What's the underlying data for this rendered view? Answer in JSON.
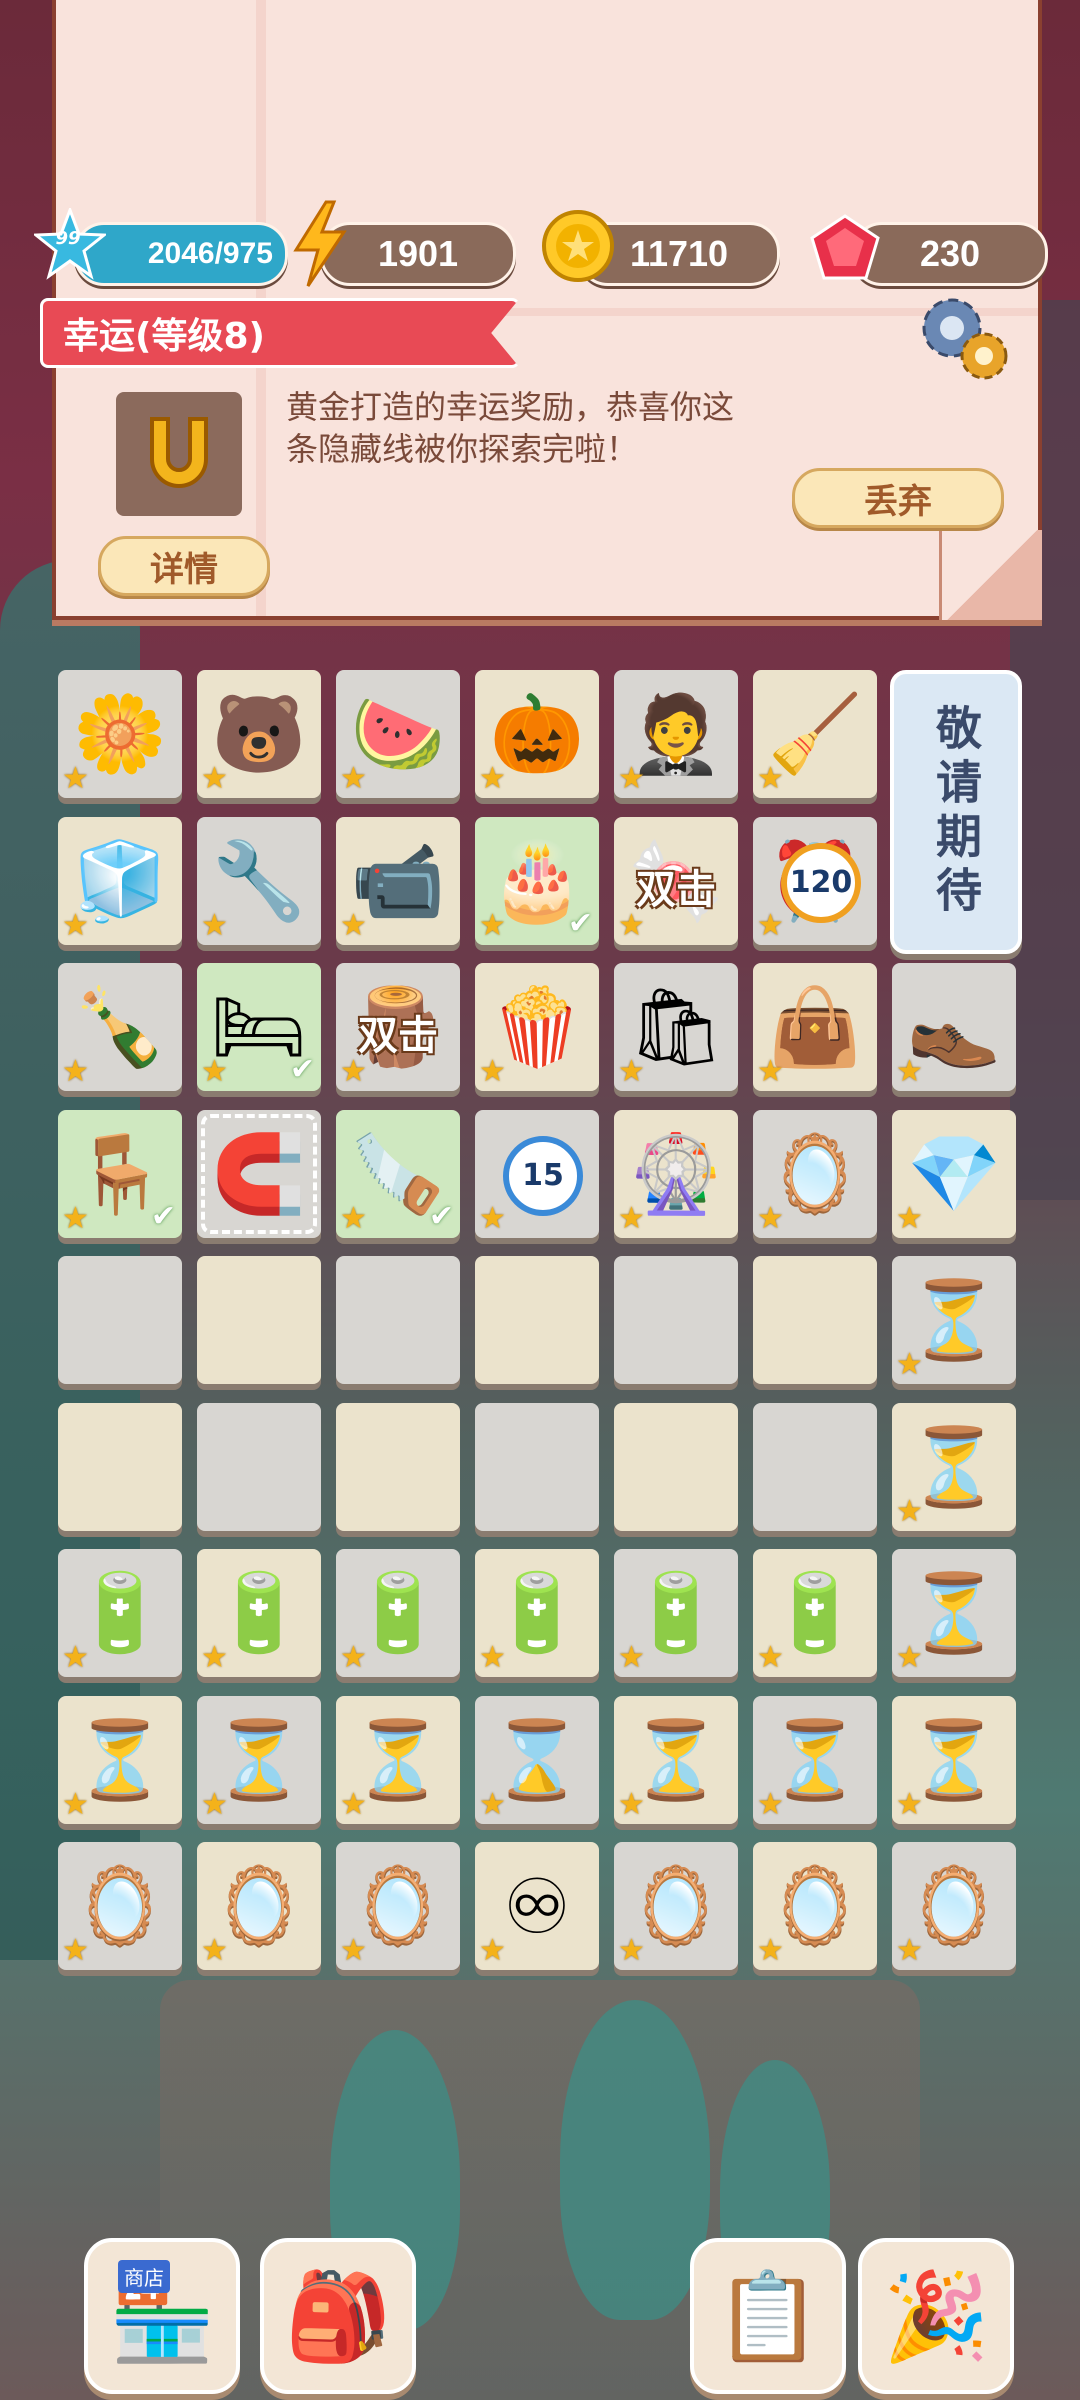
{
  "resources": {
    "exp_level": "99",
    "exp": "2046/975",
    "energy": "1901",
    "coins": "11710",
    "gems": "230"
  },
  "detail": {
    "title": "幸运(等级8)",
    "description": "黄金打造的幸运奖励，恭喜你这条隐藏线被你探索完啦！",
    "details_button": "详情",
    "discard_button": "丢弃"
  },
  "grid": {
    "coming_soon": "敬请期待",
    "combo_label": "双击",
    "timer_value": "120",
    "ball_number": "15",
    "rows": [
      [
        "daisy-flower",
        "bear",
        "watermelon",
        "pumpkin",
        "tuxedo",
        "vacuum"
      ],
      [
        "air-conditioner",
        "power-drill",
        "camcorder",
        "birthday-cake",
        "candy-jar-combo",
        "alarm-clock-120"
      ],
      [
        "wine-bottles",
        "bed",
        "firewood-combo",
        "popcorn",
        "shopping-bags",
        "pink-shopping-bag",
        "leather-shoes"
      ],
      [
        "wooden-stool",
        "horseshoe",
        "saw",
        "billiard-ball-15",
        "roulette",
        "rainbow-hand-mirror",
        "rainbow-perfume"
      ],
      [
        "empty",
        "empty",
        "empty",
        "empty",
        "empty",
        "empty",
        "hourglass"
      ],
      [
        "empty",
        "empty",
        "empty",
        "empty",
        "empty",
        "empty",
        "hourglass"
      ],
      [
        "energy-battery",
        "energy-battery",
        "energy-battery",
        "energy-battery",
        "energy-battery",
        "energy-battery",
        "hourglass"
      ],
      [
        "hourglass",
        "hourglass",
        "hourglass",
        "infinite-hourglass",
        "hourglass",
        "hourglass",
        "hourglass"
      ],
      [
        "rainbow-mirror",
        "rainbow-mirror",
        "rainbow-mirror",
        "infinite-mirror",
        "rainbow-mirror",
        "rainbow-mirror",
        "rainbow-mirror"
      ]
    ]
  },
  "bottom_bar": {
    "shop_sign": "商店",
    "buttons": [
      "shop",
      "backpack",
      "task-list",
      "celebration"
    ]
  }
}
